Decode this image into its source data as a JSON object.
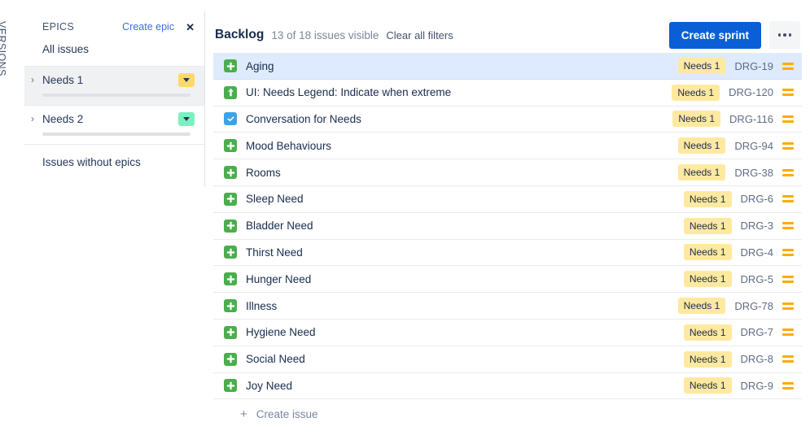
{
  "rail": {
    "versions_label": "VERSIONS"
  },
  "epics_panel": {
    "title": "EPICS",
    "create_epic_label": "Create epic",
    "close_icon": "close-icon",
    "all_issues_label": "All issues",
    "without_epics_label": "Issues without epics",
    "epics": [
      {
        "name": "Needs 1",
        "selected": true,
        "color": "#FFD966",
        "progress_pct": 0
      },
      {
        "name": "Needs 2",
        "selected": false,
        "color": "#79F2C0",
        "progress_pct": 0
      }
    ]
  },
  "backlog": {
    "title": "Backlog",
    "count_text": "13 of 18 issues visible",
    "clear_filters_label": "Clear all filters",
    "create_sprint_label": "Create sprint",
    "more_label": "more-actions",
    "create_issue_label": "Create issue",
    "create_issue_plus": "+",
    "colors": {
      "primary_button": "#0B5FD6",
      "selected_row": "#DEEBFF",
      "epic_badge": "#FFE9A0",
      "priority_medium": "#FFAB00",
      "story_icon": "#4BAD4E",
      "task_icon": "#3DA2E8"
    },
    "issues": [
      {
        "type": "story",
        "summary": "Aging",
        "epic": "Needs 1",
        "key": "DRG-19",
        "priority": "Medium",
        "selected": true
      },
      {
        "type": "improvement",
        "summary": "UI: Needs Legend: Indicate when extreme",
        "epic": "Needs 1",
        "key": "DRG-120",
        "priority": "Medium",
        "selected": false
      },
      {
        "type": "task",
        "summary": "Conversation for Needs",
        "epic": "Needs 1",
        "key": "DRG-116",
        "priority": "Medium",
        "selected": false
      },
      {
        "type": "story",
        "summary": "Mood Behaviours",
        "epic": "Needs 1",
        "key": "DRG-94",
        "priority": "Medium",
        "selected": false
      },
      {
        "type": "story",
        "summary": "Rooms",
        "epic": "Needs 1",
        "key": "DRG-38",
        "priority": "Medium",
        "selected": false
      },
      {
        "type": "story",
        "summary": "Sleep Need",
        "epic": "Needs 1",
        "key": "DRG-6",
        "priority": "Medium",
        "selected": false
      },
      {
        "type": "story",
        "summary": "Bladder Need",
        "epic": "Needs 1",
        "key": "DRG-3",
        "priority": "Medium",
        "selected": false
      },
      {
        "type": "story",
        "summary": "Thirst Need",
        "epic": "Needs 1",
        "key": "DRG-4",
        "priority": "Medium",
        "selected": false
      },
      {
        "type": "story",
        "summary": "Hunger Need",
        "epic": "Needs 1",
        "key": "DRG-5",
        "priority": "Medium",
        "selected": false
      },
      {
        "type": "story",
        "summary": "Illness",
        "epic": "Needs 1",
        "key": "DRG-78",
        "priority": "Medium",
        "selected": false
      },
      {
        "type": "story",
        "summary": "Hygiene Need",
        "epic": "Needs 1",
        "key": "DRG-7",
        "priority": "Medium",
        "selected": false
      },
      {
        "type": "story",
        "summary": "Social Need",
        "epic": "Needs 1",
        "key": "DRG-8",
        "priority": "Medium",
        "selected": false
      },
      {
        "type": "story",
        "summary": "Joy Need",
        "epic": "Needs 1",
        "key": "DRG-9",
        "priority": "Medium",
        "selected": false
      }
    ]
  }
}
